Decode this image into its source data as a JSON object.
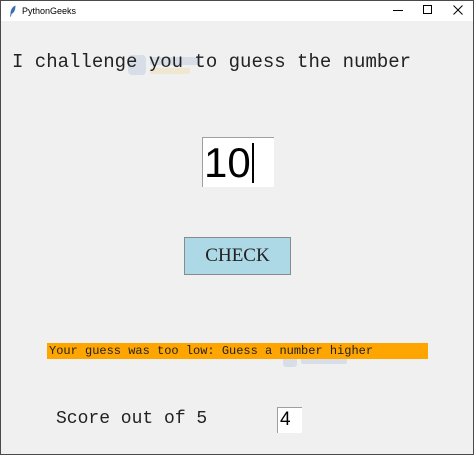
{
  "window": {
    "title": "PythonGeeks",
    "app_icon": "feather-icon",
    "controls": [
      "minimize-icon",
      "maximize-icon",
      "close-icon"
    ]
  },
  "game": {
    "heading": "I challenge you to guess the number",
    "guess_value": "10",
    "check_label": "CHECK",
    "status_message": "Your guess was too low: Guess a number higher",
    "score_label": "Score out of 5",
    "score_value": "4"
  },
  "colors": {
    "background": "#f0f0f0",
    "button": "#add8e6",
    "status": "#ffa500"
  }
}
